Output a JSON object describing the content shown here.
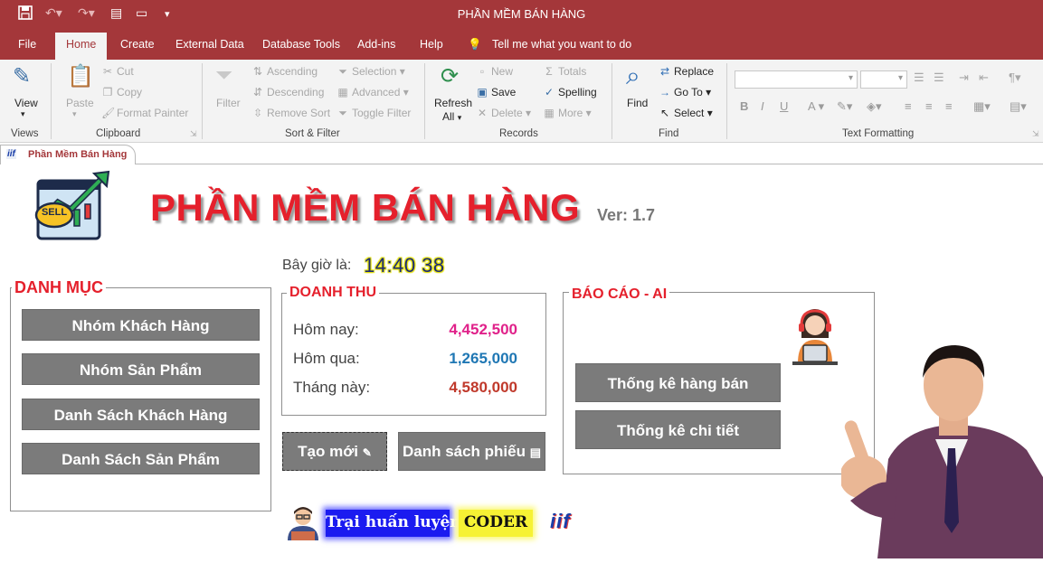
{
  "window": {
    "title": "PHẦN MỀM BÁN HÀNG"
  },
  "menu_tabs": [
    "File",
    "Home",
    "Create",
    "External Data",
    "Database Tools",
    "Add-ins",
    "Help"
  ],
  "tell_me": "Tell me what you want to do",
  "ribbon": {
    "views": {
      "view": "View",
      "group": "Views"
    },
    "clipboard": {
      "paste": "Paste",
      "cut": "Cut",
      "copy": "Copy",
      "format_painter": "Format Painter",
      "group": "Clipboard"
    },
    "sort_filter": {
      "filter": "Filter",
      "ascending": "Ascending",
      "descending": "Descending",
      "remove_sort": "Remove Sort",
      "selection": "Selection",
      "advanced": "Advanced",
      "toggle_filter": "Toggle Filter",
      "group": "Sort & Filter"
    },
    "records": {
      "refresh": "Refresh",
      "refresh_all": "All",
      "new": "New",
      "save": "Save",
      "delete": "Delete",
      "totals": "Totals",
      "spelling": "Spelling",
      "more": "More",
      "group": "Records"
    },
    "find": {
      "find": "Find",
      "replace": "Replace",
      "go_to": "Go To",
      "select": "Select",
      "group": "Find"
    },
    "text_formatting": {
      "bold": "B",
      "italic": "I",
      "underline": "U",
      "font_color": "A",
      "group": "Text Formatting"
    }
  },
  "doc_tab": {
    "label": "Phần Mềm Bán Hàng",
    "icon_text": "iif"
  },
  "form": {
    "title": "PHẦN MỀM BÁN HÀNG",
    "version": "Ver: 1.7",
    "sell_badge": "SELL",
    "time_label": "Bây giờ là:",
    "time_value": "14:40 38",
    "danh_muc": {
      "title": "DANH MỤC",
      "buttons": [
        "Nhóm Khách Hàng",
        "Nhóm Sản Phẩm",
        "Danh Sách Khách Hàng",
        "Danh Sách Sản Phẩm"
      ]
    },
    "doanh_thu": {
      "title": "DOANH THU",
      "rows": [
        {
          "label": "Hôm nay:",
          "value": "4,452,500",
          "color": "#e0218a"
        },
        {
          "label": "Hôm qua:",
          "value": "1,265,000",
          "color": "#1f77b4"
        },
        {
          "label": "Tháng này:",
          "value": "4,580,000",
          "color": "#c0392b"
        }
      ]
    },
    "actions": {
      "create_new": "Tạo mới",
      "ticket_list": "Danh sách phiếu"
    },
    "bao_cao": {
      "title": "BÁO CÁO - AI",
      "buttons": [
        "Thống kê hàng bán",
        "Thống kê chi tiết"
      ]
    },
    "footer": {
      "banner1": "Trại huấn luyện",
      "banner2": "CODER",
      "logo_text": "iif"
    }
  },
  "colors": {
    "accent": "#a4373a",
    "title_red": "#e5202c",
    "button_gray": "#7b7b7b"
  }
}
